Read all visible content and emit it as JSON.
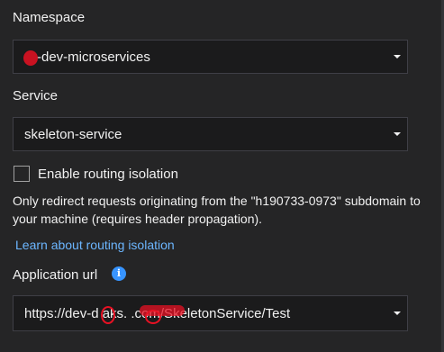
{
  "namespace": {
    "label": "Namespace",
    "value": "-dev-microservices"
  },
  "service": {
    "label": "Service",
    "value": "skeleton-service"
  },
  "routing_isolation": {
    "checkbox_label": "Enable routing isolation",
    "checked": false,
    "description": "Only redirect requests originating from the \"h190733-0973\" subdomain to your machine (requires header propagation).",
    "link_text": "Learn about routing isolation"
  },
  "application_url": {
    "label": "Application url",
    "info_icon": "info-icon",
    "value": "https://dev-d  aks.            .com/SkeletonService/Test"
  },
  "colors": {
    "background": "#252526",
    "field_background": "#1b1b1c",
    "field_border": "#3f3f46",
    "link": "#6cb6ff",
    "info": "#3794ff",
    "redaction": "#e81123"
  }
}
